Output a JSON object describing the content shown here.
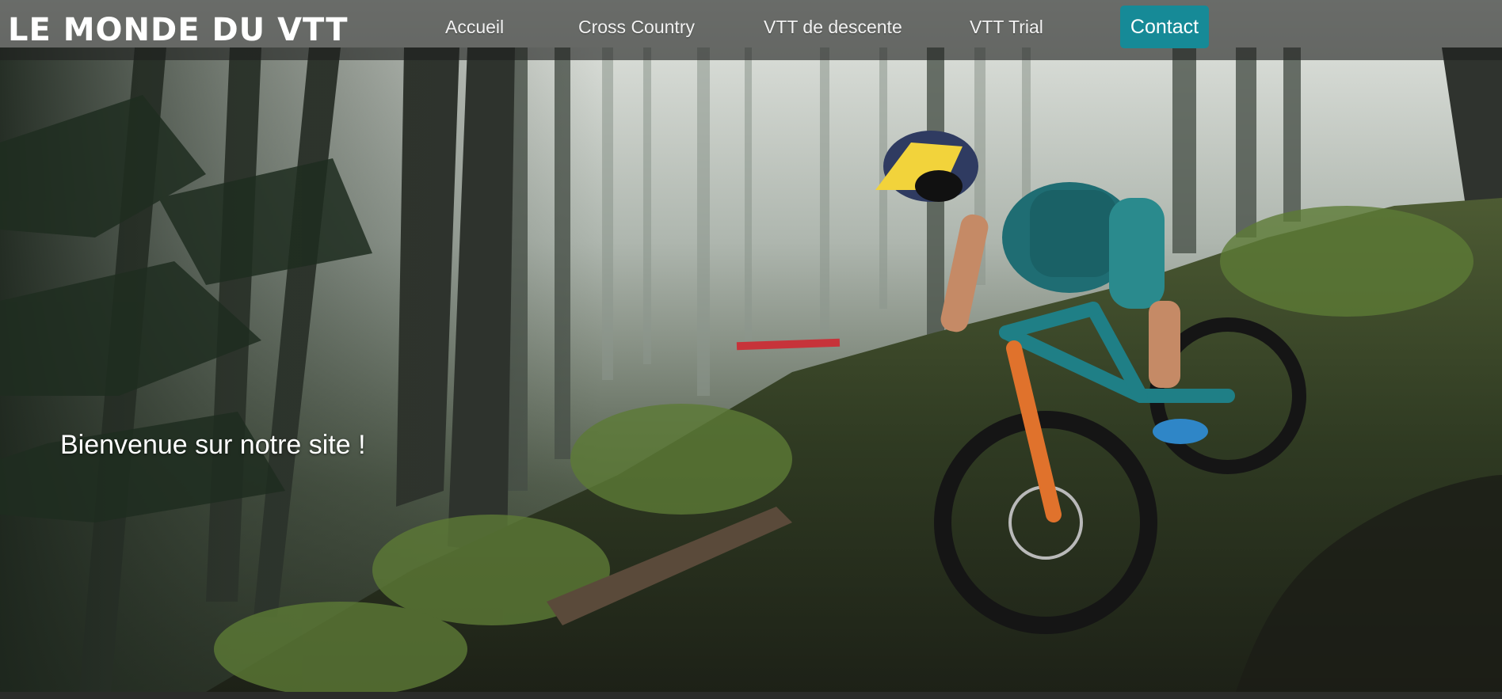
{
  "brand": {
    "title": "LE MONDE DU VTT"
  },
  "nav": {
    "items": [
      {
        "label": "Accueil"
      },
      {
        "label": "Cross Country"
      },
      {
        "label": "VTT de descente"
      },
      {
        "label": "VTT Trial"
      }
    ],
    "contact_label": "Contact"
  },
  "hero": {
    "image_subject": "mountain biker riding downhill through a misty forest",
    "welcome_text": "Bienvenue sur notre site !"
  },
  "colors": {
    "navbar_bg": "#1e201e",
    "contact_button": "#168a97",
    "text": "#ffffff",
    "bike_frame": "#1f7f86",
    "fork": "#e0722c"
  }
}
